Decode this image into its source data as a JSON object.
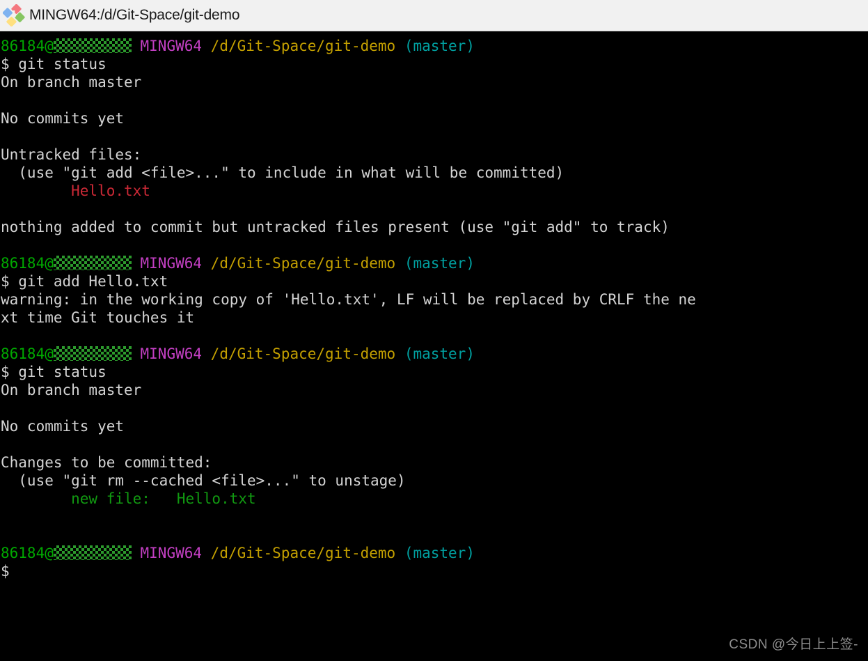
{
  "window": {
    "title": "MINGW64:/d/Git-Space/git-demo",
    "icon": "git-bash-diamond-icon",
    "titlebar_bg": "#f1f1f1",
    "terminal_bg": "#000000"
  },
  "colors": {
    "user": "#00a800",
    "shell": "#c23fc2",
    "path": "#c4a000",
    "branch": "#00a0a0",
    "untracked": "#cc2936",
    "staged": "#119911",
    "default_text": "#d4d4d4",
    "redaction": "#2c9a2c"
  },
  "prompt": {
    "user": "86184@",
    "host_redacted": true,
    "shell": "MINGW64",
    "path": "/d/Git-Space/git-demo",
    "branch": "(master)",
    "symbol": "$"
  },
  "session": [
    {
      "type": "prompt"
    },
    {
      "type": "command",
      "text": "$ git status"
    },
    {
      "type": "output",
      "text": "On branch master"
    },
    {
      "type": "blank",
      "text": " "
    },
    {
      "type": "output",
      "text": "No commits yet"
    },
    {
      "type": "blank",
      "text": " "
    },
    {
      "type": "output",
      "text": "Untracked files:"
    },
    {
      "type": "output",
      "text": "  (use \"git add <file>...\" to include in what will be committed)"
    },
    {
      "type": "untracked",
      "text": "        Hello.txt"
    },
    {
      "type": "blank",
      "text": " "
    },
    {
      "type": "output",
      "text": "nothing added to commit but untracked files present (use \"git add\" to track)"
    },
    {
      "type": "blank",
      "text": " "
    },
    {
      "type": "prompt"
    },
    {
      "type": "command",
      "text": "$ git add Hello.txt"
    },
    {
      "type": "output",
      "text": "warning: in the working copy of 'Hello.txt', LF will be replaced by CRLF the ne"
    },
    {
      "type": "output",
      "text": "xt time Git touches it"
    },
    {
      "type": "blank",
      "text": " "
    },
    {
      "type": "prompt"
    },
    {
      "type": "command",
      "text": "$ git status"
    },
    {
      "type": "output",
      "text": "On branch master"
    },
    {
      "type": "blank",
      "text": " "
    },
    {
      "type": "output",
      "text": "No commits yet"
    },
    {
      "type": "blank",
      "text": " "
    },
    {
      "type": "output",
      "text": "Changes to be committed:"
    },
    {
      "type": "output",
      "text": "  (use \"git rm --cached <file>...\" to unstage)"
    },
    {
      "type": "staged",
      "text": "        new file:   Hello.txt"
    },
    {
      "type": "blank",
      "text": " "
    },
    {
      "type": "blank",
      "text": " "
    },
    {
      "type": "prompt"
    },
    {
      "type": "command",
      "text": "$"
    }
  ],
  "watermark": {
    "text": "CSDN @今日上上签-"
  }
}
